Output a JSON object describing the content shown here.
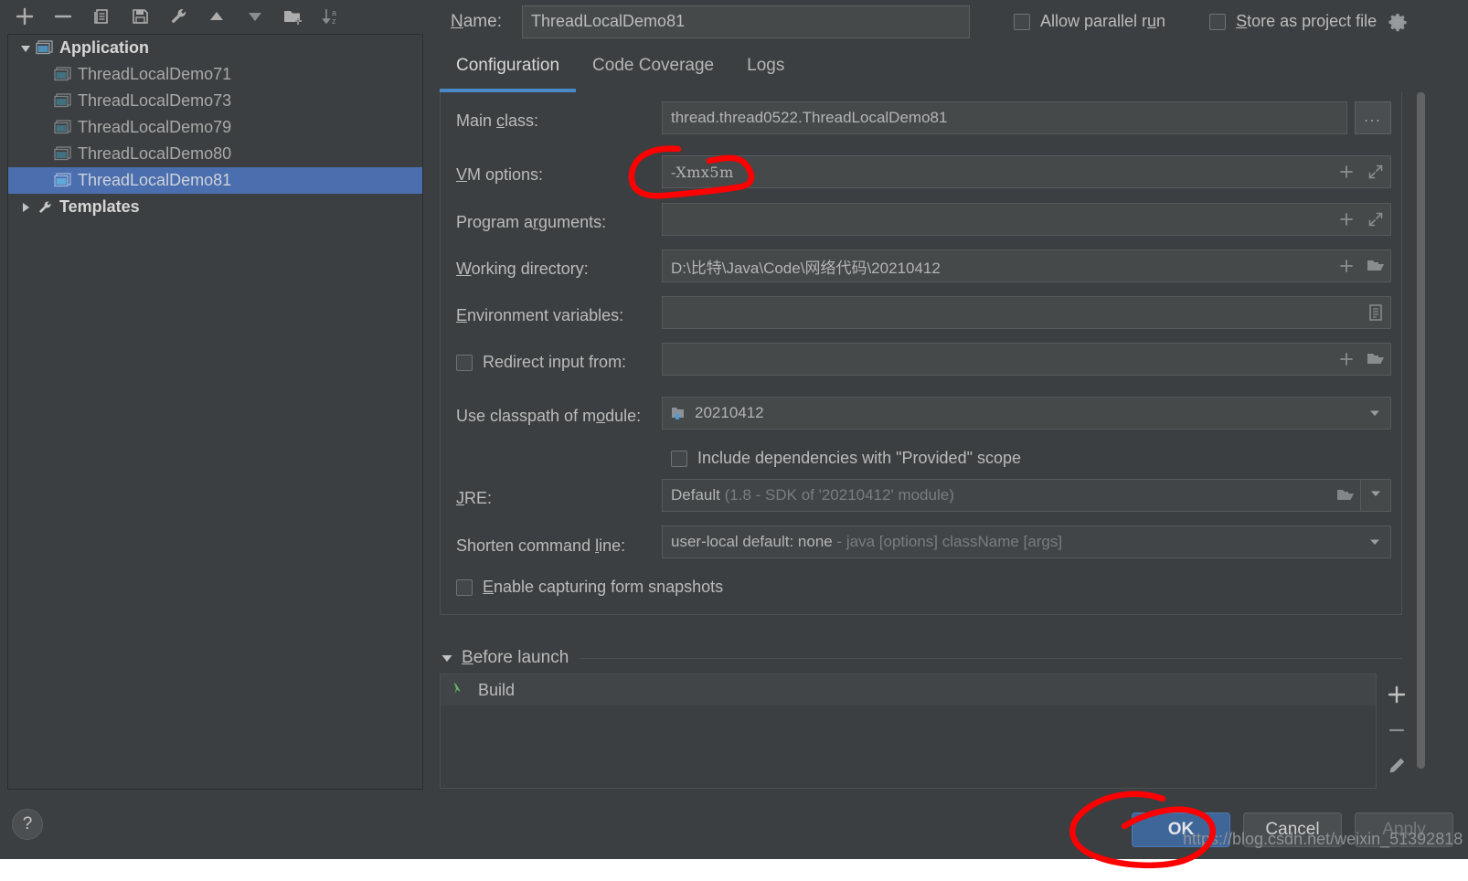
{
  "tree_toolbar": {
    "buttons": [
      {
        "name": "add-configuration-button",
        "icon": "plus-icon"
      },
      {
        "name": "remove-configuration-button",
        "icon": "minus-icon"
      },
      {
        "name": "copy-configuration-button",
        "icon": "copy-icon"
      },
      {
        "name": "save-configuration-button",
        "icon": "save-icon"
      },
      {
        "name": "edit-templates-button",
        "icon": "wrench-icon"
      },
      {
        "name": "move-up-button",
        "icon": "arrow-up-icon"
      },
      {
        "name": "move-down-button",
        "icon": "arrow-down-icon"
      },
      {
        "name": "new-folder-button",
        "icon": "folder-plus-icon"
      },
      {
        "name": "sort-configurations-button",
        "icon": "sort-az-icon"
      }
    ]
  },
  "tree": {
    "root": {
      "label": "Application",
      "expanded": true,
      "icon": "application-icon"
    },
    "children": [
      {
        "label": "ThreadLocalDemo71",
        "selected": false
      },
      {
        "label": "ThreadLocalDemo73",
        "selected": false
      },
      {
        "label": "ThreadLocalDemo79",
        "selected": false
      },
      {
        "label": "ThreadLocalDemo80",
        "selected": false
      },
      {
        "label": "ThreadLocalDemo81",
        "selected": true
      }
    ],
    "templates": {
      "label": "Templates",
      "expanded": false,
      "icon": "wrench-icon"
    }
  },
  "help": {
    "label": "?"
  },
  "header": {
    "name_label": "Name:",
    "name_value": "ThreadLocalDemo81",
    "allow_parallel_run": {
      "label": "Allow parallel run",
      "checked": false
    },
    "store_as_project_file": {
      "label": "Store as project file",
      "checked": false
    },
    "gear_icon": "gear-icon"
  },
  "tabs": [
    {
      "label": "Configuration",
      "active": true
    },
    {
      "label": "Code Coverage",
      "active": false
    },
    {
      "label": "Logs",
      "active": false
    }
  ],
  "form": {
    "main_class": {
      "label": "Main class:",
      "value": "thread.thread0522.ThreadLocalDemo81",
      "browse": "..."
    },
    "vm_options": {
      "label": "VM options:",
      "value": "-Xmx5m"
    },
    "program_arguments": {
      "label": "Program arguments:",
      "value": ""
    },
    "working_directory": {
      "label": "Working directory:",
      "value": "D:\\比特\\Java\\Code\\网络代码\\20210412"
    },
    "environment_variables": {
      "label": "Environment variables:",
      "value": ""
    },
    "redirect_input_from": {
      "label": "Redirect input from:",
      "checked": false,
      "value": ""
    },
    "use_classpath_of_module": {
      "label": "Use classpath of module:",
      "value": "20210412"
    },
    "include_provided_scope": {
      "label": "Include dependencies with \"Provided\" scope",
      "checked": false
    },
    "jre": {
      "label": "JRE:",
      "value": "Default",
      "hint": "(1.8 - SDK of '20210412' module)"
    },
    "shorten_command_line": {
      "label": "Shorten command line:",
      "value": "user-local default: none",
      "hint": "- java [options] className [args]"
    },
    "enable_form_snapshots": {
      "label": "Enable capturing form snapshots",
      "checked": false
    }
  },
  "before_launch": {
    "section_label": "Before launch",
    "expanded": true,
    "items": [
      {
        "label": "Build",
        "icon": "build-hammer-icon"
      }
    ],
    "side_buttons": [
      {
        "name": "add-task-button",
        "icon": "plus-icon"
      },
      {
        "name": "remove-task-button",
        "icon": "minus-icon"
      },
      {
        "name": "edit-task-button",
        "icon": "pencil-icon"
      }
    ]
  },
  "buttons": {
    "ok": "OK",
    "cancel": "Cancel",
    "apply": "Apply"
  },
  "watermark": "https://blog.csdn.net/weixin_51392818",
  "colors": {
    "background": "#3c3f41",
    "selection": "#4b6eaf",
    "accent": "#4a88c7",
    "primary_button": "#3f6699",
    "annotation": "#fe0000",
    "field_background": "#45494a"
  }
}
